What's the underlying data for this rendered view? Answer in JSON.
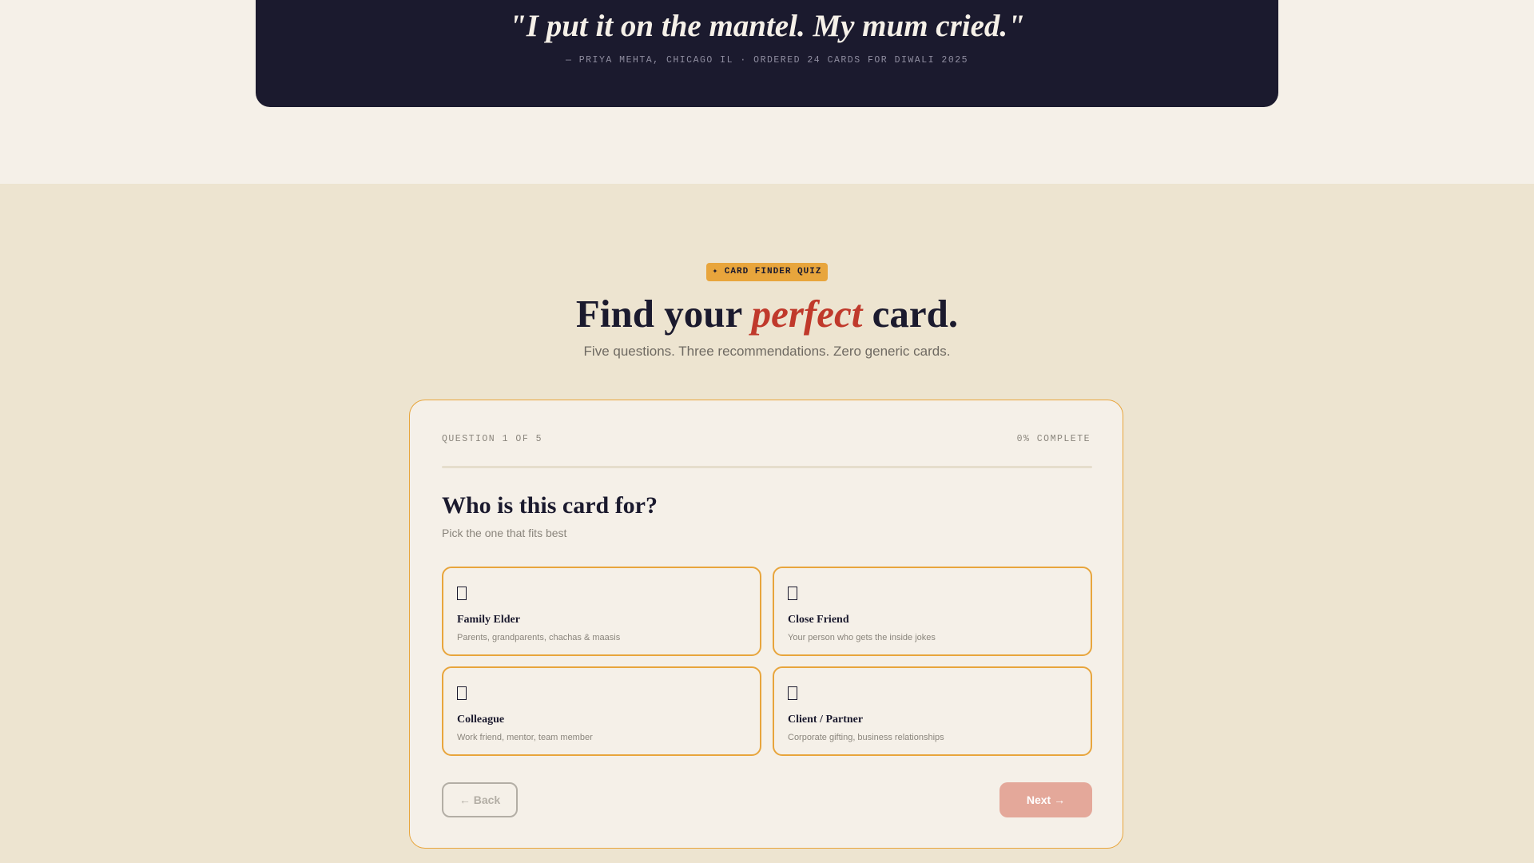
{
  "testimonial": {
    "quote": "\"I put it on the mantel. My mum cried.\"",
    "attribution": "— PRIYA MEHTA, CHICAGO IL · ORDERED 24 CARDS FOR DIWALI 2025"
  },
  "quiz_intro": {
    "badge": "✦ CARD FINDER QUIZ",
    "heading_before": "Find your ",
    "heading_accent": "perfect",
    "heading_after": " card.",
    "subheading": "Five questions. Three recommendations. Zero generic cards."
  },
  "quiz": {
    "progress_label": "QUESTION 1 OF 5",
    "complete_label": "0% COMPLETE",
    "progress_fraction": 0,
    "question": "Who is this card for?",
    "hint": "Pick the one that fits best",
    "options": [
      {
        "label": "Family Elder",
        "desc": "Parents, grandparents, chachas & maasis",
        "icon": "missing-glyph-icon"
      },
      {
        "label": "Close Friend",
        "desc": "Your person who gets the inside jokes",
        "icon": "missing-glyph-icon"
      },
      {
        "label": "Colleague",
        "desc": "Work friend, mentor, team member",
        "icon": "missing-glyph-icon"
      },
      {
        "label": "Client / Partner",
        "desc": "Corporate gifting, business relationships",
        "icon": "missing-glyph-icon"
      }
    ],
    "back_label": "← Back",
    "next_label": "Next →"
  },
  "colors": {
    "navy": "#1b1a2e",
    "accent_red": "#c0392b",
    "gold": "#e8a53c",
    "cream": "#f5f0e8",
    "section_bg": "#ede4d0",
    "next_button": "#e4a89a"
  }
}
